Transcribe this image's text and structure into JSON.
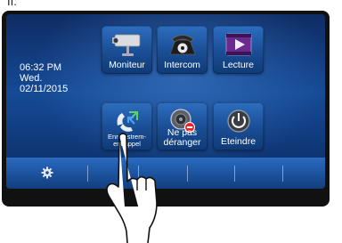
{
  "figure_label": "II.",
  "status": {
    "time": "06:32 PM",
    "day": "Wed.",
    "date": "02/11/2015"
  },
  "tiles": [
    {
      "label": "Moniteur",
      "icon": "camera-icon"
    },
    {
      "label": "Intercom",
      "icon": "telephone-icon"
    },
    {
      "label": "Lecture",
      "icon": "play-video-icon"
    },
    {
      "label_line1": "Enregistrem-",
      "label_line2": "ent appel",
      "icon": "phone-arrows-icon"
    },
    {
      "label_line1": "Ne pas",
      "label_line2": "déranger",
      "icon": "do-not-disturb-icon"
    },
    {
      "label": "Eteindre",
      "icon": "power-icon"
    }
  ],
  "taskbar": {
    "settings_icon": "gear-icon"
  },
  "colors": {
    "screen": "#154a96",
    "tile": "#1a4d94",
    "taskbar": "#1a4f99",
    "dnd_badge": "#e0262a"
  }
}
